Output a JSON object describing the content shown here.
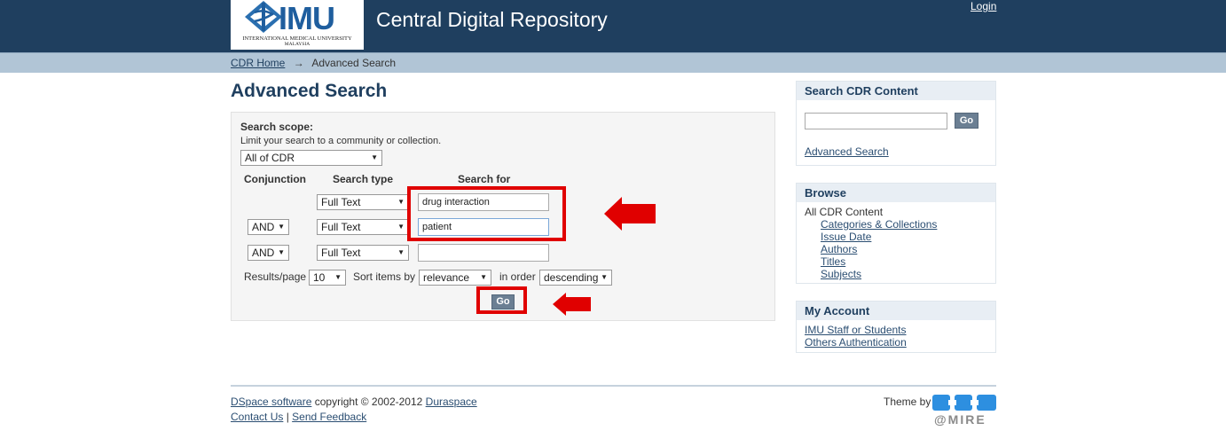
{
  "header": {
    "logo_text": "IMU",
    "logo_sub1": "INTERNATIONAL MEDICAL UNIVERSITY",
    "logo_sub2": "MALAYSIA",
    "site_title": "Central Digital Repository",
    "login_label": "Login"
  },
  "breadcrumb": {
    "home": "CDR Home",
    "arrow": "→",
    "current": "Advanced Search"
  },
  "page": {
    "title": "Advanced Search"
  },
  "search_form": {
    "scope_label": "Search scope:",
    "scope_hint": "Limit your search to a community or collection.",
    "scope_value": "All of CDR",
    "col_conjunction": "Conjunction",
    "col_type": "Search type",
    "col_for": "Search for",
    "rows": [
      {
        "conjunction": "",
        "type": "Full Text",
        "query": "drug interaction"
      },
      {
        "conjunction": "AND",
        "type": "Full Text",
        "query": "patient"
      },
      {
        "conjunction": "AND",
        "type": "Full Text",
        "query": ""
      }
    ],
    "results_label": "Results/page",
    "results_value": "10",
    "sort_label": "Sort items by",
    "sort_value": "relevance",
    "order_label": "in order",
    "order_value": "descending",
    "go_label": "Go"
  },
  "sidebar": {
    "search": {
      "title": "Search CDR Content",
      "go_label": "Go",
      "advanced_link": "Advanced Search",
      "query": ""
    },
    "browse": {
      "title": "Browse",
      "all_label": "All CDR Content",
      "items": [
        "Categories & Collections",
        "Issue Date",
        "Authors",
        "Titles",
        "Subjects"
      ]
    },
    "account": {
      "title": "My Account",
      "items": [
        "IMU Staff or Students",
        "Others Authentication"
      ]
    }
  },
  "footer": {
    "dspace": "DSpace software",
    "copyright": " copyright © 2002-2012 ",
    "duraspace": "Duraspace",
    "contact": "Contact Us",
    "sep": " | ",
    "feedback": "Send Feedback",
    "theme_by": "Theme by",
    "mire": "@MIRE"
  },
  "colors": {
    "header_bg": "#1f3f5f",
    "highlight": "#e00000",
    "link": "#2b4e72"
  },
  "icons": {
    "annotation": "red-arrow-icon"
  }
}
